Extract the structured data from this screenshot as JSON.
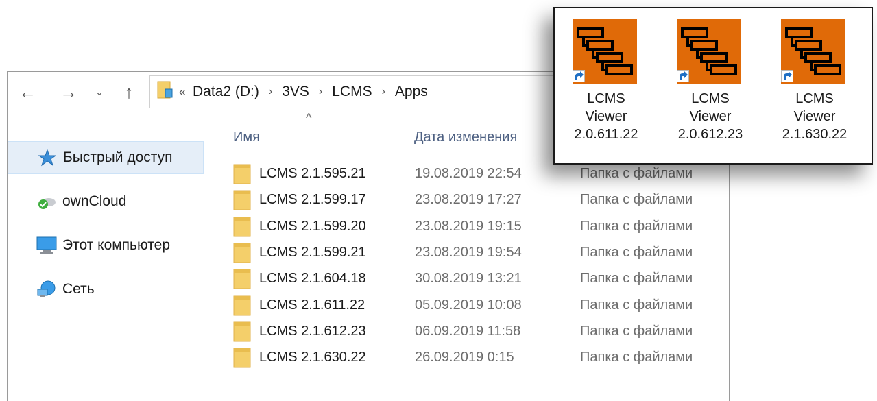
{
  "address_bar": {
    "overflow": "«",
    "crumbs": [
      "Data2 (D:)",
      "3VS",
      "LCMS",
      "Apps"
    ]
  },
  "sidebar": {
    "items": [
      {
        "label": "Быстрый доступ",
        "icon": "star-icon"
      },
      {
        "label": "ownCloud",
        "icon": "owncloud-icon"
      },
      {
        "label": "Этот компьютер",
        "icon": "computer-icon"
      },
      {
        "label": "Сеть",
        "icon": "network-icon"
      }
    ]
  },
  "columns": {
    "name": "Имя",
    "date": "Дата изменения"
  },
  "files": [
    {
      "name": "LCMS 2.1.595.21",
      "date": "19.08.2019 22:54",
      "type": "Папка с файлами"
    },
    {
      "name": "LCMS 2.1.599.17",
      "date": "23.08.2019 17:27",
      "type": "Папка с файлами"
    },
    {
      "name": "LCMS 2.1.599.20",
      "date": "23.08.2019 19:15",
      "type": "Папка с файлами"
    },
    {
      "name": "LCMS 2.1.599.21",
      "date": "23.08.2019 19:54",
      "type": "Папка с файлами"
    },
    {
      "name": "LCMS 2.1.604.18",
      "date": "30.08.2019 13:21",
      "type": "Папка с файлами"
    },
    {
      "name": "LCMS 2.1.611.22",
      "date": "05.09.2019 10:08",
      "type": "Папка с файлами"
    },
    {
      "name": "LCMS 2.1.612.23",
      "date": "06.09.2019 11:58",
      "type": "Папка с файлами"
    },
    {
      "name": "LCMS 2.1.630.22",
      "date": "26.09.2019 0:15",
      "type": "Папка с файлами"
    }
  ],
  "shortcuts": [
    {
      "line1": "LCMS",
      "line2": "Viewer",
      "line3": "2.0.611.22"
    },
    {
      "line1": "LCMS",
      "line2": "Viewer",
      "line3": "2.0.612.23"
    },
    {
      "line1": "LCMS",
      "line2": "Viewer",
      "line3": "2.1.630.22"
    }
  ],
  "colors": {
    "accent_orange": "#e06a08",
    "folder_yellow": "#f4cf6a",
    "selected_bg": "#e5eef8"
  }
}
